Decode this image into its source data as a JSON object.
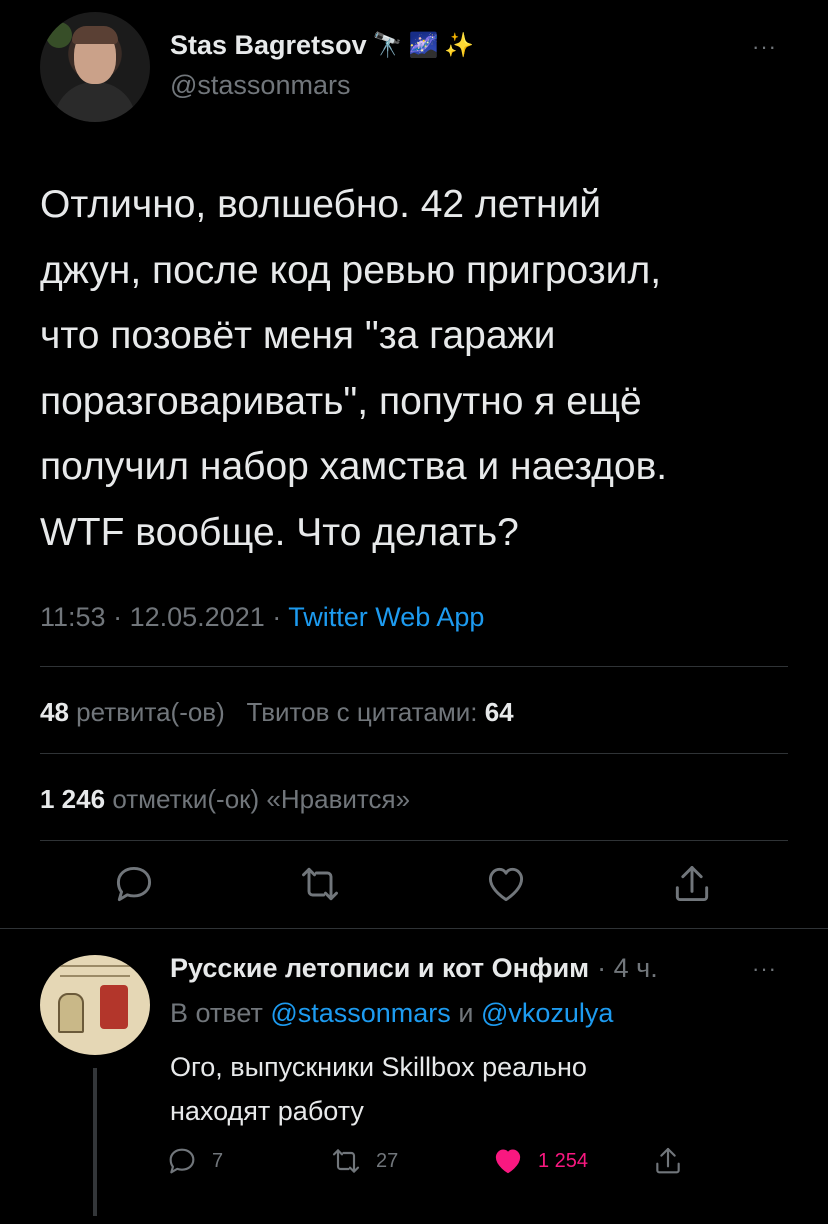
{
  "tweet": {
    "display_name": "Stas Bagretsov",
    "name_emojis": [
      "🔭",
      "🌌",
      "✨"
    ],
    "handle": "@stassonmars",
    "more": "···",
    "text": "Отлично, волшебно. 42 летний\nджун, после код ревью пригрозил,\nчто позовёт меня \"за гаражи\nпоразговаривать\", попутно я ещё\nполучил набор хамства и наездов.\nWTF вообще. Что делать?",
    "time": "11:53",
    "date": "12.05.2021",
    "sep": "·",
    "source": "Twitter Web App",
    "retweets_count": "48",
    "retweets_label": "ретвита(-ов)",
    "quotes_label": "Твитов с цитатами:",
    "quotes_count": "64",
    "likes_count": "1 246",
    "likes_label": "отметки(-ок) «Нравится»"
  },
  "actions": {
    "reply_icon": "reply-icon",
    "retweet_icon": "retweet-icon",
    "like_icon": "heart-icon",
    "share_icon": "share-icon"
  },
  "reply": {
    "display_name": "Русские летописи и кот Онфим",
    "time": "· 4 ч.",
    "more": "···",
    "reply_prefix": "В ответ",
    "mention1": "@stassonmars",
    "conjunction": "и",
    "mention2": "@vkozulya",
    "text": "Ого, выпускники Skillbox реально\nнаходят работу",
    "replies_count": "7",
    "retweets_count": "27",
    "likes_count": "1 254",
    "like_color": "#f91880"
  }
}
